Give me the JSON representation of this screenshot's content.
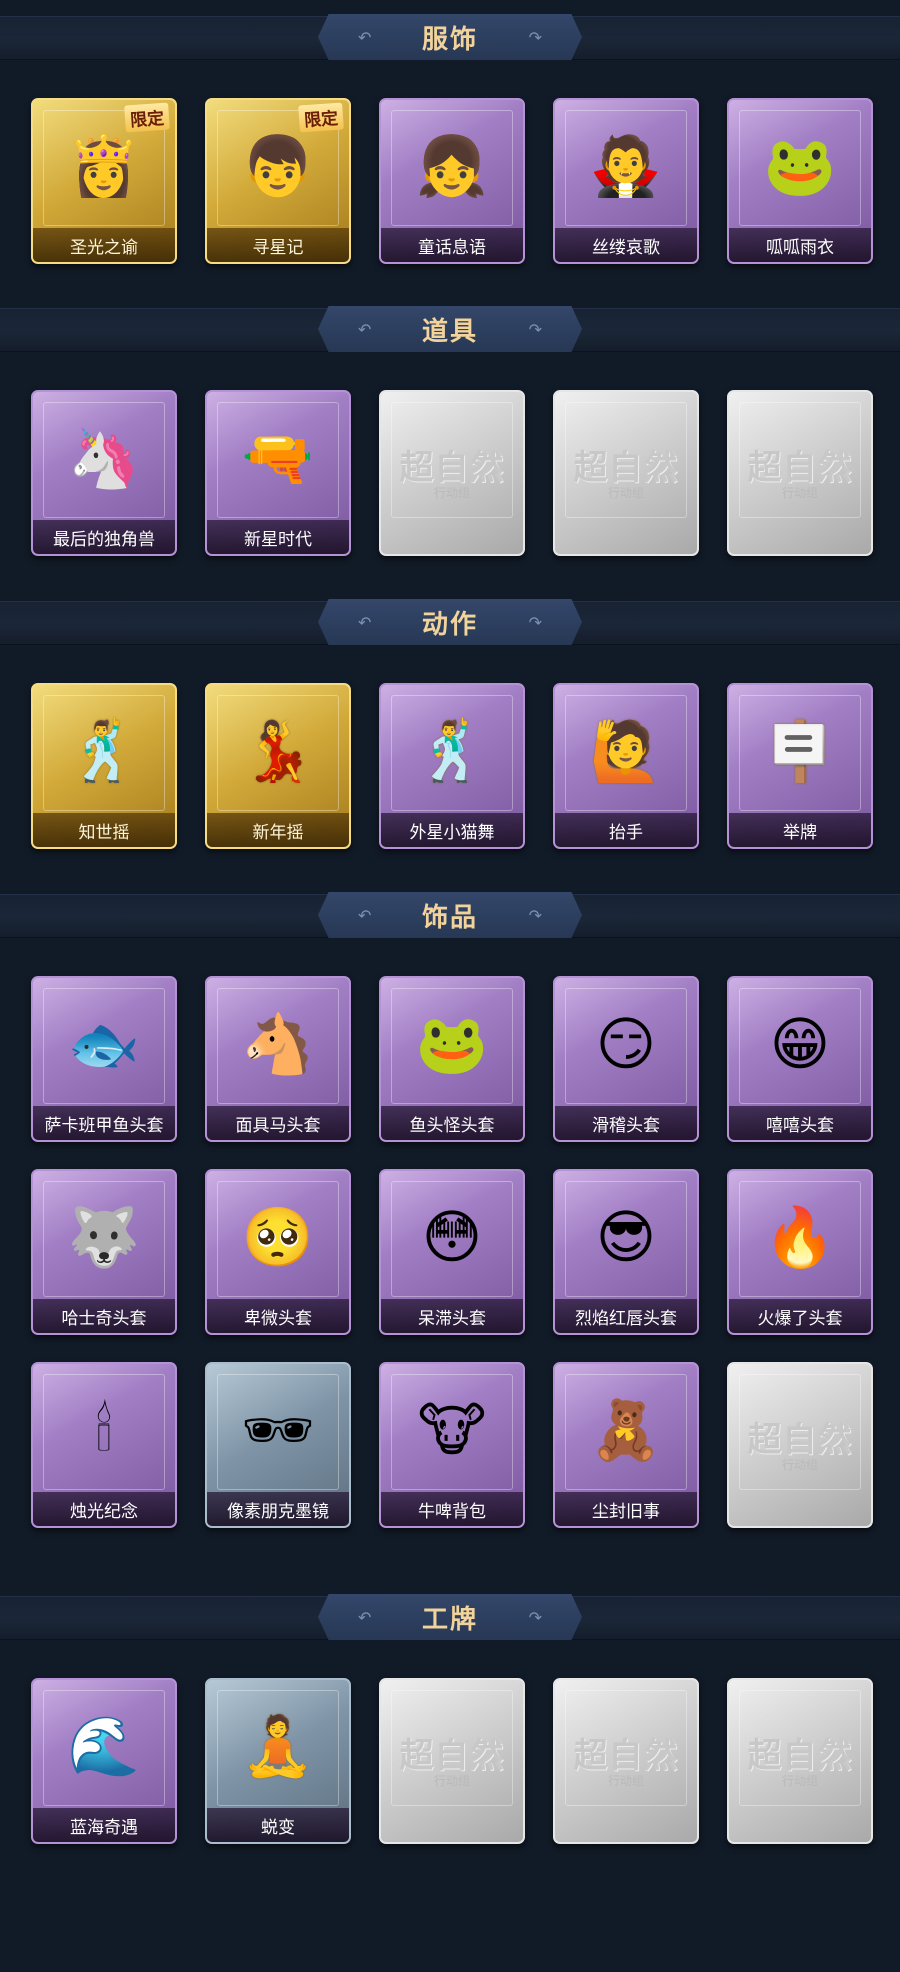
{
  "sections": [
    {
      "title": "服饰",
      "rows": [
        [
          {
            "label": "圣光之谕",
            "style": "gold",
            "icon": "blonde-princess-avatar-icon",
            "glyph": "👸",
            "badge": "限定"
          },
          {
            "label": "寻星记",
            "style": "gold",
            "icon": "blonde-boy-avatar-icon",
            "glyph": "👦",
            "badge": "限定"
          },
          {
            "label": "童话息语",
            "style": "purple",
            "icon": "red-haired-girl-avatar-icon",
            "glyph": "👧"
          },
          {
            "label": "丝缕哀歌",
            "style": "purple",
            "icon": "gothic-girl-avatar-icon",
            "glyph": "🧛"
          },
          {
            "label": "呱呱雨衣",
            "style": "purple",
            "icon": "frog-raincoat-girl-avatar-icon",
            "glyph": "🐸"
          }
        ]
      ]
    },
    {
      "title": "道具",
      "rows": [
        [
          {
            "label": "最后的独角兽",
            "style": "purple",
            "icon": "unicorn-horn-lance-icon",
            "glyph": "🦄"
          },
          {
            "label": "新星时代",
            "style": "purple",
            "icon": "revolver-icon",
            "glyph": "🔫"
          },
          {
            "label": "",
            "style": "silver",
            "icon": "placeholder-logo-icon",
            "watermark": "超自然",
            "watermark_sub": "行动组"
          },
          {
            "label": "",
            "style": "silver",
            "icon": "placeholder-logo-icon",
            "watermark": "超自然",
            "watermark_sub": "行动组"
          },
          {
            "label": "",
            "style": "silver",
            "icon": "placeholder-logo-icon",
            "watermark": "超自然",
            "watermark_sub": "行动组"
          }
        ]
      ]
    },
    {
      "title": "动作",
      "rows": [
        [
          {
            "label": "知世摇",
            "style": "gold",
            "icon": "dancing-figure-icon",
            "glyph": "🕺",
            "silhouette": true
          },
          {
            "label": "新年摇",
            "style": "gold",
            "icon": "dancing-figure-icon",
            "glyph": "💃",
            "silhouette": true
          },
          {
            "label": "外星小猫舞",
            "style": "purple",
            "icon": "dancing-figure-icon",
            "glyph": "🕺",
            "silhouette": true
          },
          {
            "label": "抬手",
            "style": "purple",
            "icon": "raise-hand-figure-icon",
            "glyph": "🙋",
            "silhouette": true
          },
          {
            "label": "举牌",
            "style": "purple",
            "icon": "hold-sign-figure-icon",
            "glyph": "🪧",
            "silhouette": true
          }
        ]
      ]
    },
    {
      "title": "饰品",
      "rows": [
        [
          {
            "label": "萨卡班甲鱼头套",
            "style": "purple",
            "icon": "fish-head-mask-icon",
            "glyph": "🐟"
          },
          {
            "label": "面具马头套",
            "style": "purple",
            "icon": "horse-head-mask-icon",
            "glyph": "🐴"
          },
          {
            "label": "鱼头怪头套",
            "style": "purple",
            "icon": "green-fish-monster-mask-icon",
            "glyph": "🐸"
          },
          {
            "label": "滑稽头套",
            "style": "purple",
            "icon": "smirk-emoji-mask-icon",
            "glyph": "😏"
          },
          {
            "label": "嘻嘻头套",
            "style": "purple",
            "icon": "grin-emoji-mask-icon",
            "glyph": "😁"
          }
        ],
        [
          {
            "label": "哈士奇头套",
            "style": "purple",
            "icon": "husky-with-sunglasses-icon",
            "glyph": "🐺"
          },
          {
            "label": "卑微头套",
            "style": "purple",
            "icon": "pleading-emoji-mask-icon",
            "glyph": "🥺"
          },
          {
            "label": "呆滞头套",
            "style": "purple",
            "icon": "dazed-emoji-mask-icon",
            "glyph": "😳"
          },
          {
            "label": "烈焰红唇头套",
            "style": "purple",
            "icon": "yellow-mouse-sunglasses-mask-icon",
            "glyph": "😎"
          },
          {
            "label": "火爆了头套",
            "style": "purple",
            "icon": "fire-spirit-mask-icon",
            "glyph": "🔥"
          }
        ],
        [
          {
            "label": "烛光纪念",
            "style": "purple",
            "icon": "candle-mascot-icon",
            "glyph": "🕯"
          },
          {
            "label": "像素朋克墨镜",
            "style": "steel",
            "icon": "pixel-sunglasses-icon",
            "glyph": "🕶"
          },
          {
            "label": "牛啤背包",
            "style": "purple",
            "icon": "cow-beer-backpack-icon",
            "glyph": "🐮"
          },
          {
            "label": "尘封旧事",
            "style": "purple",
            "icon": "chibi-charm-icon",
            "glyph": "🧸"
          },
          {
            "label": "",
            "style": "silver",
            "icon": "placeholder-logo-icon",
            "watermark": "超自然",
            "watermark_sub": "行动组"
          }
        ]
      ]
    },
    {
      "title": "工牌",
      "rows": [
        [
          {
            "label": "蓝海奇遇",
            "style": "purple",
            "icon": "ocean-badge-card-icon",
            "glyph": "🌊"
          },
          {
            "label": "蜕变",
            "style": "steel",
            "icon": "silhouette-badge-card-icon",
            "glyph": "🧘",
            "silhouette": true
          },
          {
            "label": "",
            "style": "silver",
            "icon": "placeholder-logo-icon",
            "watermark": "超自然",
            "watermark_sub": "行动组"
          },
          {
            "label": "",
            "style": "silver",
            "icon": "placeholder-logo-icon",
            "watermark": "超自然",
            "watermark_sub": "行动组"
          },
          {
            "label": "",
            "style": "silver",
            "icon": "placeholder-logo-icon",
            "watermark": "超自然",
            "watermark_sub": "行动组"
          }
        ]
      ]
    }
  ]
}
